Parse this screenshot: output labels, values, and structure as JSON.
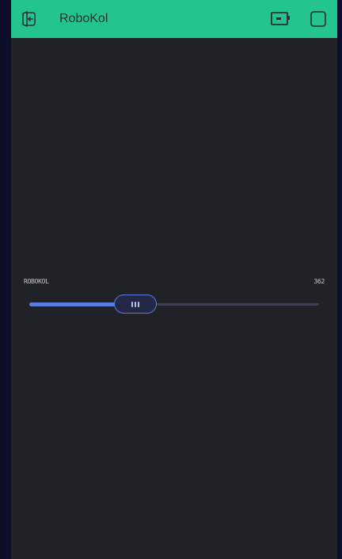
{
  "app": {
    "title": "RoboKol",
    "accent_color": "#23c48e",
    "background_color": "#212227"
  },
  "header": {
    "back_icon": "exit-icon",
    "battery_icon": "battery-icon",
    "stop_icon": "square-icon"
  },
  "slider": {
    "label": "ROBOKOL",
    "value_text": "362",
    "fill_fraction": 0.365,
    "fill_color": "#5b7ae0"
  }
}
